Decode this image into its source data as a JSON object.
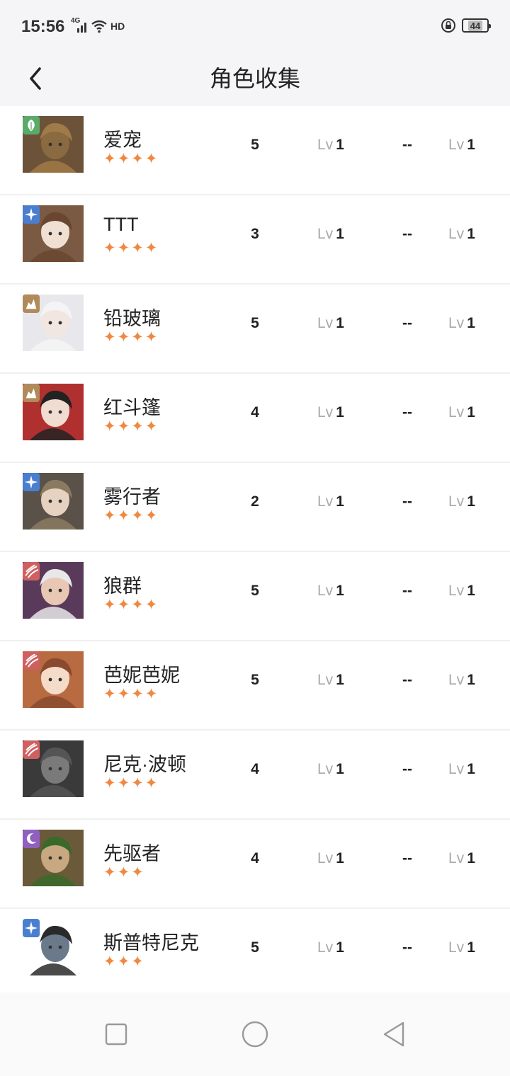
{
  "status": {
    "time": "15:56",
    "network": "4G",
    "hd": "HD",
    "battery": "44"
  },
  "header": {
    "title": "角色收集"
  },
  "labels": {
    "lv_prefix": "Lv"
  },
  "characters": [
    {
      "name": "爱宠",
      "stars": 4,
      "stars_text": "✦✦✦✦",
      "count": "5",
      "level": "1",
      "stat": "--",
      "level2": "1",
      "element": "leaf",
      "element_color": "#5aaa6a"
    },
    {
      "name": "TTT",
      "stars": 4,
      "stars_text": "✦✦✦✦",
      "count": "3",
      "level": "1",
      "stat": "--",
      "level2": "1",
      "element": "star",
      "element_color": "#4a7fd0"
    },
    {
      "name": "铅玻璃",
      "stars": 4,
      "stars_text": "✦✦✦✦",
      "count": "5",
      "level": "1",
      "stat": "--",
      "level2": "1",
      "element": "rock",
      "element_color": "#b08a5a"
    },
    {
      "name": "红斗篷",
      "stars": 4,
      "stars_text": "✦✦✦✦",
      "count": "4",
      "level": "1",
      "stat": "--",
      "level2": "1",
      "element": "rock",
      "element_color": "#b08a5a"
    },
    {
      "name": "雾行者",
      "stars": 4,
      "stars_text": "✦✦✦✦",
      "count": "2",
      "level": "1",
      "stat": "--",
      "level2": "1",
      "element": "star",
      "element_color": "#4a7fd0"
    },
    {
      "name": "狼群",
      "stars": 4,
      "stars_text": "✦✦✦✦",
      "count": "5",
      "level": "1",
      "stat": "--",
      "level2": "1",
      "element": "claw",
      "element_color": "#d06060"
    },
    {
      "name": "芭妮芭妮",
      "stars": 4,
      "stars_text": "✦✦✦✦",
      "count": "5",
      "level": "1",
      "stat": "--",
      "level2": "1",
      "element": "claw",
      "element_color": "#d06060"
    },
    {
      "name": "尼克·波顿",
      "stars": 4,
      "stars_text": "✦✦✦✦",
      "count": "4",
      "level": "1",
      "stat": "--",
      "level2": "1",
      "element": "claw",
      "element_color": "#d06060"
    },
    {
      "name": "先驱者",
      "stars": 3,
      "stars_text": "✦✦✦",
      "count": "4",
      "level": "1",
      "stat": "--",
      "level2": "1",
      "element": "moon",
      "element_color": "#9060c0"
    },
    {
      "name": "斯普特尼克",
      "stars": 3,
      "stars_text": "✦✦✦",
      "count": "5",
      "level": "1",
      "stat": "--",
      "level2": "1",
      "element": "star",
      "element_color": "#4a7fd0"
    }
  ],
  "avatars": [
    {
      "icon": "scarecrow-portrait",
      "bg": "#6b5238",
      "hair": "#a07a48",
      "skin": "#8a6a40"
    },
    {
      "icon": "girl-portrait",
      "bg": "#7a5a42",
      "hair": "#6a4630",
      "skin": "#f0e0d4"
    },
    {
      "icon": "white-hair-portrait",
      "bg": "#e8e8ec",
      "hair": "#f4f4f6",
      "skin": "#f2e6e0"
    },
    {
      "icon": "red-cloak-portrait",
      "bg": "#b03030",
      "hair": "#222222",
      "skin": "#f0dcd0"
    },
    {
      "icon": "top-hat-portrait",
      "bg": "#5a5248",
      "hair": "#8a7a62",
      "skin": "#e6d2c0"
    },
    {
      "icon": "glasses-man-portrait",
      "bg": "#5a3a5a",
      "hair": "#e8e8e8",
      "skin": "#e8c8b4"
    },
    {
      "icon": "cheer-girl-portrait",
      "bg": "#b86a40",
      "hair": "#8a4a30",
      "skin": "#f4dcc8"
    },
    {
      "icon": "horse-head-portrait",
      "bg": "#3a3a3a",
      "hair": "#555555",
      "skin": "#7a7a7a"
    },
    {
      "icon": "explorer-portrait",
      "bg": "#6a5a3a",
      "hair": "#3a6a2a",
      "skin": "#c8a880"
    },
    {
      "icon": "satellite-portrait",
      "bg": "#ffffff",
      "hair": "#2a2a2a",
      "skin": "#6a7a8a"
    }
  ]
}
